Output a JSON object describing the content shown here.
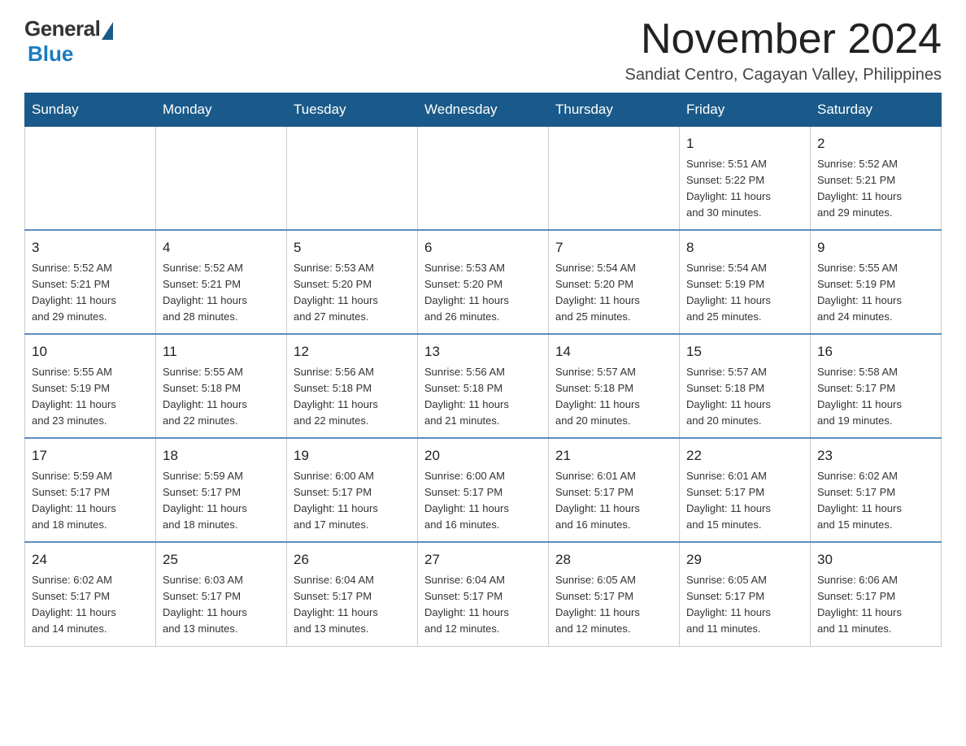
{
  "logo": {
    "general": "General",
    "blue": "Blue"
  },
  "header": {
    "month_year": "November 2024",
    "location": "Sandiat Centro, Cagayan Valley, Philippines"
  },
  "weekdays": [
    "Sunday",
    "Monday",
    "Tuesday",
    "Wednesday",
    "Thursday",
    "Friday",
    "Saturday"
  ],
  "weeks": [
    [
      {
        "day": "",
        "info": ""
      },
      {
        "day": "",
        "info": ""
      },
      {
        "day": "",
        "info": ""
      },
      {
        "day": "",
        "info": ""
      },
      {
        "day": "",
        "info": ""
      },
      {
        "day": "1",
        "info": "Sunrise: 5:51 AM\nSunset: 5:22 PM\nDaylight: 11 hours\nand 30 minutes."
      },
      {
        "day": "2",
        "info": "Sunrise: 5:52 AM\nSunset: 5:21 PM\nDaylight: 11 hours\nand 29 minutes."
      }
    ],
    [
      {
        "day": "3",
        "info": "Sunrise: 5:52 AM\nSunset: 5:21 PM\nDaylight: 11 hours\nand 29 minutes."
      },
      {
        "day": "4",
        "info": "Sunrise: 5:52 AM\nSunset: 5:21 PM\nDaylight: 11 hours\nand 28 minutes."
      },
      {
        "day": "5",
        "info": "Sunrise: 5:53 AM\nSunset: 5:20 PM\nDaylight: 11 hours\nand 27 minutes."
      },
      {
        "day": "6",
        "info": "Sunrise: 5:53 AM\nSunset: 5:20 PM\nDaylight: 11 hours\nand 26 minutes."
      },
      {
        "day": "7",
        "info": "Sunrise: 5:54 AM\nSunset: 5:20 PM\nDaylight: 11 hours\nand 25 minutes."
      },
      {
        "day": "8",
        "info": "Sunrise: 5:54 AM\nSunset: 5:19 PM\nDaylight: 11 hours\nand 25 minutes."
      },
      {
        "day": "9",
        "info": "Sunrise: 5:55 AM\nSunset: 5:19 PM\nDaylight: 11 hours\nand 24 minutes."
      }
    ],
    [
      {
        "day": "10",
        "info": "Sunrise: 5:55 AM\nSunset: 5:19 PM\nDaylight: 11 hours\nand 23 minutes."
      },
      {
        "day": "11",
        "info": "Sunrise: 5:55 AM\nSunset: 5:18 PM\nDaylight: 11 hours\nand 22 minutes."
      },
      {
        "day": "12",
        "info": "Sunrise: 5:56 AM\nSunset: 5:18 PM\nDaylight: 11 hours\nand 22 minutes."
      },
      {
        "day": "13",
        "info": "Sunrise: 5:56 AM\nSunset: 5:18 PM\nDaylight: 11 hours\nand 21 minutes."
      },
      {
        "day": "14",
        "info": "Sunrise: 5:57 AM\nSunset: 5:18 PM\nDaylight: 11 hours\nand 20 minutes."
      },
      {
        "day": "15",
        "info": "Sunrise: 5:57 AM\nSunset: 5:18 PM\nDaylight: 11 hours\nand 20 minutes."
      },
      {
        "day": "16",
        "info": "Sunrise: 5:58 AM\nSunset: 5:17 PM\nDaylight: 11 hours\nand 19 minutes."
      }
    ],
    [
      {
        "day": "17",
        "info": "Sunrise: 5:59 AM\nSunset: 5:17 PM\nDaylight: 11 hours\nand 18 minutes."
      },
      {
        "day": "18",
        "info": "Sunrise: 5:59 AM\nSunset: 5:17 PM\nDaylight: 11 hours\nand 18 minutes."
      },
      {
        "day": "19",
        "info": "Sunrise: 6:00 AM\nSunset: 5:17 PM\nDaylight: 11 hours\nand 17 minutes."
      },
      {
        "day": "20",
        "info": "Sunrise: 6:00 AM\nSunset: 5:17 PM\nDaylight: 11 hours\nand 16 minutes."
      },
      {
        "day": "21",
        "info": "Sunrise: 6:01 AM\nSunset: 5:17 PM\nDaylight: 11 hours\nand 16 minutes."
      },
      {
        "day": "22",
        "info": "Sunrise: 6:01 AM\nSunset: 5:17 PM\nDaylight: 11 hours\nand 15 minutes."
      },
      {
        "day": "23",
        "info": "Sunrise: 6:02 AM\nSunset: 5:17 PM\nDaylight: 11 hours\nand 15 minutes."
      }
    ],
    [
      {
        "day": "24",
        "info": "Sunrise: 6:02 AM\nSunset: 5:17 PM\nDaylight: 11 hours\nand 14 minutes."
      },
      {
        "day": "25",
        "info": "Sunrise: 6:03 AM\nSunset: 5:17 PM\nDaylight: 11 hours\nand 13 minutes."
      },
      {
        "day": "26",
        "info": "Sunrise: 6:04 AM\nSunset: 5:17 PM\nDaylight: 11 hours\nand 13 minutes."
      },
      {
        "day": "27",
        "info": "Sunrise: 6:04 AM\nSunset: 5:17 PM\nDaylight: 11 hours\nand 12 minutes."
      },
      {
        "day": "28",
        "info": "Sunrise: 6:05 AM\nSunset: 5:17 PM\nDaylight: 11 hours\nand 12 minutes."
      },
      {
        "day": "29",
        "info": "Sunrise: 6:05 AM\nSunset: 5:17 PM\nDaylight: 11 hours\nand 11 minutes."
      },
      {
        "day": "30",
        "info": "Sunrise: 6:06 AM\nSunset: 5:17 PM\nDaylight: 11 hours\nand 11 minutes."
      }
    ]
  ]
}
